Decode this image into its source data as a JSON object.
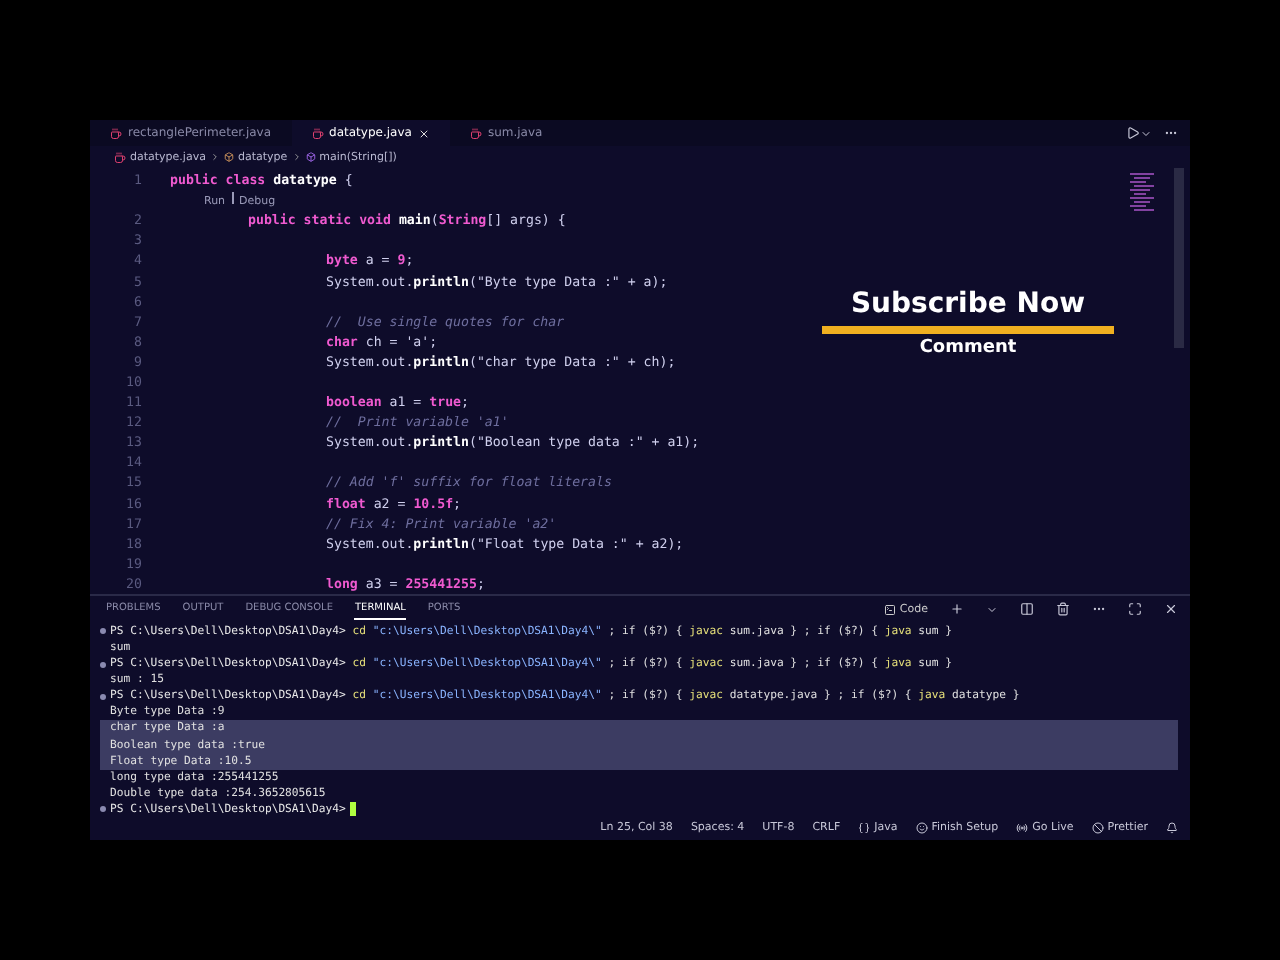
{
  "editor_tabs": [
    {
      "label": "rectanglePerimeter.java",
      "selected": false
    },
    {
      "label": "datatype.java",
      "selected": true
    },
    {
      "label": "sum.java",
      "selected": false
    }
  ],
  "breadcrumb": [
    "datatype.java",
    "datatype",
    "main(String[])"
  ],
  "code_lines": [
    {
      "number": "1",
      "kind": "class",
      "tokens": [
        {
          "kind": "kw",
          "text": "public class "
        },
        {
          "kind": "fn",
          "text": "datatype"
        },
        {
          "kind": "plain",
          "text": " {"
        }
      ]
    },
    {
      "kind": "lens",
      "links": [
        "Run",
        "Debug"
      ]
    },
    {
      "number": "2",
      "kind": "method",
      "tokens": [
        {
          "kind": "kw",
          "text": "public static void "
        },
        {
          "kind": "fn",
          "text": "main"
        },
        {
          "kind": "plain",
          "text": "("
        },
        {
          "kind": "kw",
          "text": "String"
        },
        {
          "kind": "plain",
          "text": "[] args) {"
        }
      ]
    },
    {
      "number": "3",
      "kind": "blank"
    },
    {
      "number": "4",
      "kind": "body",
      "tokens": [
        {
          "kind": "kw",
          "text": "byte "
        },
        {
          "kind": "plain",
          "text": "a = "
        },
        {
          "kind": "kw",
          "text": "9"
        },
        {
          "kind": "plain",
          "text": ";"
        }
      ]
    },
    {
      "number": "5",
      "kind": "body",
      "tokens": [
        {
          "kind": "plain",
          "text": "System.out."
        },
        {
          "kind": "fn",
          "text": "println"
        },
        {
          "kind": "plain",
          "text": "(\"Byte type Data :\" + a);"
        }
      ]
    },
    {
      "number": "6",
      "kind": "blank"
    },
    {
      "number": "7",
      "kind": "body",
      "tokens": [
        {
          "kind": "comment",
          "text": "//  Use single quotes for char"
        }
      ]
    },
    {
      "number": "8",
      "kind": "body",
      "tokens": [
        {
          "kind": "kw",
          "text": "char "
        },
        {
          "kind": "plain",
          "text": "ch = 'a';"
        }
      ]
    },
    {
      "number": "9",
      "kind": "body",
      "tokens": [
        {
          "kind": "plain",
          "text": "System.out."
        },
        {
          "kind": "fn",
          "text": "println"
        },
        {
          "kind": "plain",
          "text": "(\"char type Data :\" + ch);"
        }
      ]
    },
    {
      "number": "10",
      "kind": "blank"
    },
    {
      "number": "11",
      "kind": "body",
      "tokens": [
        {
          "kind": "kw",
          "text": "boolean "
        },
        {
          "kind": "plain",
          "text": "a1 = "
        },
        {
          "kind": "kw",
          "text": "true"
        },
        {
          "kind": "plain",
          "text": ";"
        }
      ]
    },
    {
      "number": "12",
      "kind": "body",
      "tokens": [
        {
          "kind": "comment",
          "text": "//  Print variable 'a1'"
        }
      ]
    },
    {
      "number": "13",
      "kind": "body",
      "tokens": [
        {
          "kind": "plain",
          "text": "System.out."
        },
        {
          "kind": "fn",
          "text": "println"
        },
        {
          "kind": "plain",
          "text": "(\"Boolean type data :\" + a1);"
        }
      ]
    },
    {
      "number": "14",
      "kind": "blank"
    },
    {
      "number": "15",
      "kind": "body",
      "tokens": [
        {
          "kind": "comment",
          "text": "// Add 'f' suffix for float literals"
        }
      ]
    },
    {
      "number": "16",
      "kind": "body",
      "tokens": [
        {
          "kind": "kw",
          "text": "float "
        },
        {
          "kind": "plain",
          "text": "a2 = "
        },
        {
          "kind": "kw",
          "text": "10.5f"
        },
        {
          "kind": "plain",
          "text": ";"
        }
      ]
    },
    {
      "number": "17",
      "kind": "body",
      "tokens": [
        {
          "kind": "comment",
          "text": "// Fix 4: Print variable 'a2'"
        }
      ]
    },
    {
      "number": "18",
      "kind": "body",
      "tokens": [
        {
          "kind": "plain",
          "text": "System.out."
        },
        {
          "kind": "fn",
          "text": "println"
        },
        {
          "kind": "plain",
          "text": "(\"Float type Data :\" + a2);"
        }
      ]
    },
    {
      "number": "19",
      "kind": "blank"
    },
    {
      "number": "20",
      "kind": "body",
      "tokens": [
        {
          "kind": "kw",
          "text": "long "
        },
        {
          "kind": "plain",
          "text": "a3 = "
        },
        {
          "kind": "kw",
          "text": "255441255"
        },
        {
          "kind": "plain",
          "text": ";"
        }
      ]
    }
  ],
  "overlay": {
    "title": "Subscribe Now",
    "subtitle": "Comment"
  },
  "panel_tabs": [
    {
      "label": "PROBLEMS",
      "selected": false
    },
    {
      "label": "OUTPUT",
      "selected": false
    },
    {
      "label": "DEBUG CONSOLE",
      "selected": false
    },
    {
      "label": "TERMINAL",
      "selected": true
    },
    {
      "label": "PORTS",
      "selected": false
    }
  ],
  "terminal_name": "Code",
  "terminal_lines": [
    {
      "kind": "command",
      "tokens": [
        {
          "kind": "prompt",
          "text": "PS C:\\Users\\Dell\\Desktop\\DSA1\\Day4> "
        },
        {
          "kind": "cmd",
          "text": "cd "
        },
        {
          "kind": "path",
          "text": "\"c:\\Users\\Dell\\Desktop\\DSA1\\Day4\\\""
        },
        {
          "kind": "plain",
          "text": " ; if ($?) { "
        },
        {
          "kind": "cmd",
          "text": "javac"
        },
        {
          "kind": "plain",
          "text": " sum.java } ; if ($?) { "
        },
        {
          "kind": "cmd",
          "text": "java"
        },
        {
          "kind": "plain",
          "text": " sum }"
        }
      ]
    },
    {
      "kind": "output",
      "text": "sum",
      "selected": false
    },
    {
      "kind": "command",
      "tokens": [
        {
          "kind": "prompt",
          "text": "PS C:\\Users\\Dell\\Desktop\\DSA1\\Day4> "
        },
        {
          "kind": "cmd",
          "text": "cd "
        },
        {
          "kind": "path",
          "text": "\"c:\\Users\\Dell\\Desktop\\DSA1\\Day4\\\""
        },
        {
          "kind": "plain",
          "text": " ; if ($?) { "
        },
        {
          "kind": "cmd",
          "text": "javac"
        },
        {
          "kind": "plain",
          "text": " sum.java } ; if ($?) { "
        },
        {
          "kind": "cmd",
          "text": "java"
        },
        {
          "kind": "plain",
          "text": " sum }"
        }
      ]
    },
    {
      "kind": "output",
      "text": "sum : 15",
      "selected": false
    },
    {
      "kind": "command",
      "tokens": [
        {
          "kind": "prompt",
          "text": "PS C:\\Users\\Dell\\Desktop\\DSA1\\Day4> "
        },
        {
          "kind": "cmd",
          "text": "cd "
        },
        {
          "kind": "path",
          "text": "\"c:\\Users\\Dell\\Desktop\\DSA1\\Day4\\\""
        },
        {
          "kind": "plain",
          "text": " ; if ($?) { "
        },
        {
          "kind": "cmd",
          "text": "javac"
        },
        {
          "kind": "plain",
          "text": " datatype.java } ; if ($?) { "
        },
        {
          "kind": "cmd",
          "text": "java"
        },
        {
          "kind": "plain",
          "text": " datatype }"
        }
      ]
    },
    {
      "kind": "output",
      "text": "Byte type Data :9",
      "selected": false
    },
    {
      "kind": "output",
      "text": "char type Data :a",
      "selected": true
    },
    {
      "kind": "output",
      "text": "Boolean type data :true",
      "selected": true
    },
    {
      "kind": "output",
      "text": "Float type Data :10.5",
      "selected": true
    },
    {
      "kind": "output",
      "text": "long type data :255441255",
      "selected": false
    },
    {
      "kind": "output",
      "text": "Double type data :254.3652805615",
      "selected": false
    },
    {
      "kind": "prompt",
      "tokens": [
        {
          "kind": "prompt",
          "text": "PS C:\\Users\\Dell\\Desktop\\DSA1\\Day4>"
        }
      ]
    }
  ],
  "status_bar": [
    {
      "kind": "position",
      "text": "Ln 25, Col 38"
    },
    {
      "kind": "indent",
      "text": "Spaces: 4"
    },
    {
      "kind": "encoding",
      "text": "UTF-8"
    },
    {
      "kind": "eol",
      "text": "CRLF"
    },
    {
      "kind": "language",
      "text": "Java"
    },
    {
      "kind": "setup",
      "text": "Finish Setup"
    },
    {
      "kind": "live",
      "text": "Go Live"
    },
    {
      "kind": "formatter",
      "text": "Prettier"
    },
    {
      "kind": "notifications"
    }
  ]
}
